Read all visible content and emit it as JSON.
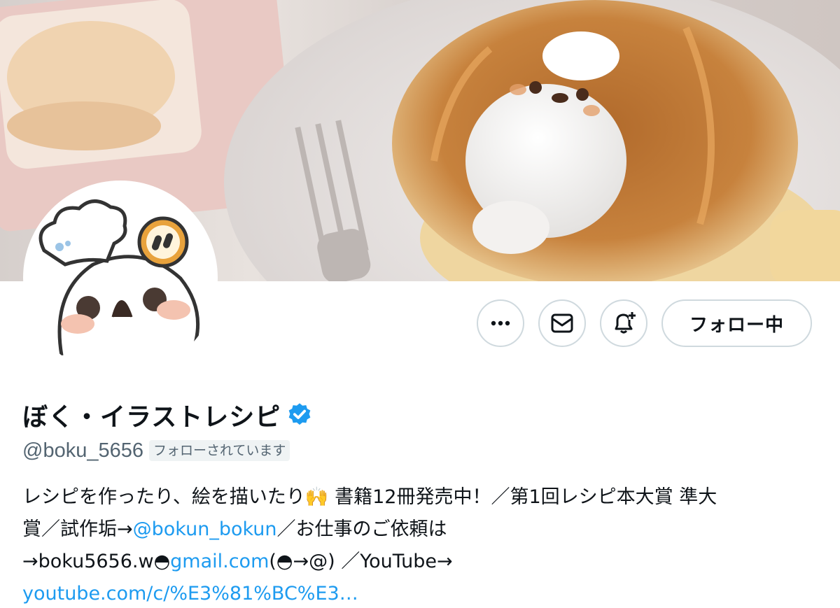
{
  "profile": {
    "display_name": "ぼく・イラストレシピ",
    "handle": "@boku_5656",
    "follows_you_badge": "フォローされています",
    "verified": true
  },
  "actions": {
    "more_label": "⋯",
    "follow_label": "フォロー中"
  },
  "bio": {
    "line1_text": "レシピを作ったり、絵を描いたり🙌 書籍12冊発売中！／第1回レシピ本大賞 準大",
    "line2_prefix": "賞／試作垢→",
    "line2_mention": "@bokun_bokun",
    "line2_suffix": "／お仕事のご依頼は",
    "line3_prefix": "→boku5656.w◓",
    "line3_link": "gmail.com",
    "line3_suffix": "(◓→@) ／YouTube→",
    "line4_link": "youtube.com/c/%E3%81%BC%E3…"
  },
  "colors": {
    "accent": "#1d9bf0",
    "text_primary": "#0f1419",
    "text_secondary": "#536471",
    "border": "#cfd9de"
  },
  "icons": {
    "more": "more-horizontal-icon",
    "mail": "envelope-icon",
    "notify": "bell-plus-icon",
    "verified": "verified-badge-icon"
  }
}
